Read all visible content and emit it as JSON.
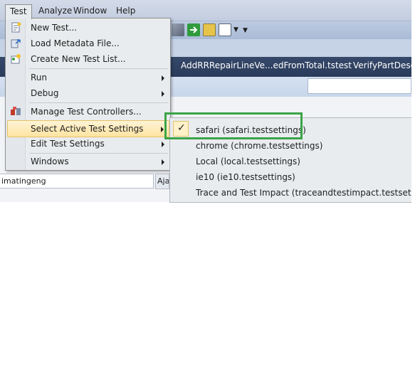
{
  "menubar": {
    "items": [
      {
        "label": "Test"
      },
      {
        "label": "Analyze"
      },
      {
        "label": "Window"
      },
      {
        "label": "Help"
      }
    ]
  },
  "toolbar": {
    "icons": [
      "wrench-icon",
      "green-arrow-icon",
      "nodes-icon",
      "window-icon",
      "dropdown-arrow-icon"
    ]
  },
  "tabs": [
    {
      "label": "AddRRRepairLineVe...edFromTotal.tstest"
    },
    {
      "label": "VerifyPartDesele"
    }
  ],
  "underlying": {
    "field_value": "imatingeng",
    "button_label": "Aja"
  },
  "test_menu": {
    "items": [
      {
        "label": "New Test...",
        "icon": "new-test-icon"
      },
      {
        "label": "Load Metadata File...",
        "icon": "load-metadata-icon"
      },
      {
        "label": "Create New Test List...",
        "icon": "test-list-icon"
      },
      {
        "label": "Run"
      },
      {
        "label": "Debug"
      },
      {
        "label": "Manage Test Controllers...",
        "icon": "test-controllers-icon"
      },
      {
        "label": "Select Active Test Settings"
      },
      {
        "label": "Edit Test Settings"
      },
      {
        "label": "Windows"
      }
    ]
  },
  "submenu": {
    "items": [
      {
        "label": "safari (safari.testsettings)",
        "checked": true
      },
      {
        "label": "chrome (chrome.testsettings)"
      },
      {
        "label": "Local (local.testsettings)"
      },
      {
        "label": "ie10 (ie10.testsettings)"
      },
      {
        "label": "Trace and Test Impact (traceandtestimpact.testsettings)"
      }
    ],
    "check_glyph": "✓"
  },
  "colors": {
    "highlight_frame": "#3aa448",
    "menu_background": "#e9ecee",
    "tab_strip": "#2e4062"
  }
}
